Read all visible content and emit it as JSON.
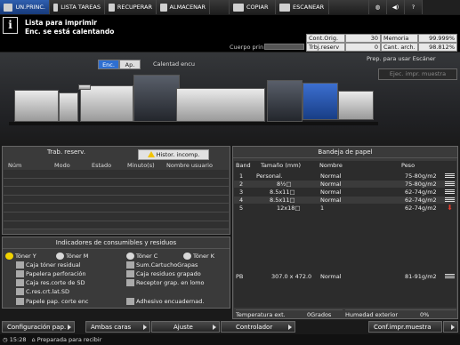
{
  "topbar": {
    "tabs": [
      {
        "label": "UN.PRINC.",
        "icon": "printer-icon",
        "active": true
      },
      {
        "label": "LISTA TAREAS",
        "icon": "job-list-icon",
        "active": false
      },
      {
        "label": "RECUPERAR",
        "icon": "recall-icon",
        "active": false
      },
      {
        "label": "ALMACENAR",
        "icon": "store-icon",
        "active": false
      },
      {
        "label": "COPIAR",
        "icon": "copy-icon",
        "active": false
      },
      {
        "label": "ESCANEAR",
        "icon": "scan-icon",
        "active": false
      }
    ],
    "right_icons": [
      "globe-icon",
      "volume-icon",
      "help-icon"
    ]
  },
  "message": {
    "line1": "Lista para imprimir",
    "line2": "Enc. se está calentando"
  },
  "body_print_label": "Cuerpo prin.",
  "counters": {
    "cont_orig_label": "Cont.Orig.",
    "cont_orig_value": "30",
    "memoria_label": "Memoria",
    "memoria_value": "99.999%",
    "trbj_reserv_label": "Trbj.reserv",
    "trbj_reserv_value": "0",
    "cant_arch_label": "Cant. arch.",
    "cant_arch_value": "98.812%"
  },
  "power": {
    "enc_label": "Enc.",
    "ap_label": "Ap.",
    "selected": "Enc.",
    "status": "Calentad encu"
  },
  "prep_scanner": "Prep. para usar Escáner",
  "eject_button": "Ejec. impr. muestra",
  "jobs_panel": {
    "title": "Trab. reserv.",
    "history_button": "Histor. incomp.",
    "columns": [
      "Núm",
      "Modo",
      "Estado",
      "Minuto(s)",
      "Nombre usuario"
    ],
    "rows": []
  },
  "consumables_panel": {
    "title": "Indicadores de consumibles y residuos",
    "items": [
      {
        "label": "Tóner Y",
        "icon": "toner-y-icon"
      },
      {
        "label": "Tóner M",
        "icon": "toner-m-icon"
      },
      {
        "label": "Tóner C",
        "icon": "toner-c-icon"
      },
      {
        "label": "Tóner K",
        "icon": "toner-k-icon"
      },
      {
        "label": "Caja tóner residual",
        "icon": "waste-toner-icon"
      },
      {
        "label": "Sum.CartuchoGrapas",
        "icon": "staple-cartridge-icon"
      },
      {
        "label": "Papelera perforación",
        "icon": "punch-waste-icon"
      },
      {
        "label": "Caja residuos grapado",
        "icon": "staple-waste-icon"
      },
      {
        "label": "Caja res.corte de SD",
        "icon": "trim-waste-icon"
      },
      {
        "label": "Receptor grap. en lomo",
        "icon": "spine-staple-icon"
      },
      {
        "label": "C.res.crt.lat.SD",
        "icon": "side-trim-icon"
      },
      {
        "label": "Papele pap. corte enc",
        "icon": "cut-paper-icon"
      },
      {
        "label": "Adhesivo encuadernad.",
        "icon": "adhesive-icon"
      }
    ]
  },
  "tray_panel": {
    "title": "Bandeja de papel",
    "columns": [
      "Band",
      "Tamaño (mm)",
      "Nombre",
      "Peso"
    ],
    "rows": [
      {
        "band": "1",
        "size": "Personal.",
        "name": "Normal",
        "weight": "75-80g/m2",
        "level": "full"
      },
      {
        "band": "2",
        "size": "8½□",
        "name": "Normal",
        "weight": "75-80g/m2",
        "level": "full"
      },
      {
        "band": "3",
        "size": "8.5x11□",
        "name": "Normal",
        "weight": "62-74g/m2",
        "level": "full"
      },
      {
        "band": "4",
        "size": "8.5x11□",
        "name": "Normal",
        "weight": "62-74g/m2",
        "level": "full"
      },
      {
        "band": "5",
        "size": "12x18□",
        "name": "1",
        "weight": "62-74g/m2",
        "level": "empty"
      }
    ],
    "pb_row": {
      "band": "PB",
      "size": "307.0 x 472.0",
      "name": "Normal",
      "weight": "81-91g/m2"
    },
    "temp_label": "Temperatura ext.",
    "temp_value": "0Grados",
    "humidity_label": "Humedad exterior",
    "humidity_value": "0%"
  },
  "bottom_buttons": [
    "Configuración pap.",
    "Ambas caras",
    "Ajuste",
    "Controlador",
    "Conf.impr.muestra"
  ],
  "footer": {
    "time": "15:28",
    "status": "Preparada para recibir"
  },
  "colors": {
    "accent": "#2f6fd1",
    "warning": "#f2c300",
    "error": "#e23c2c"
  }
}
